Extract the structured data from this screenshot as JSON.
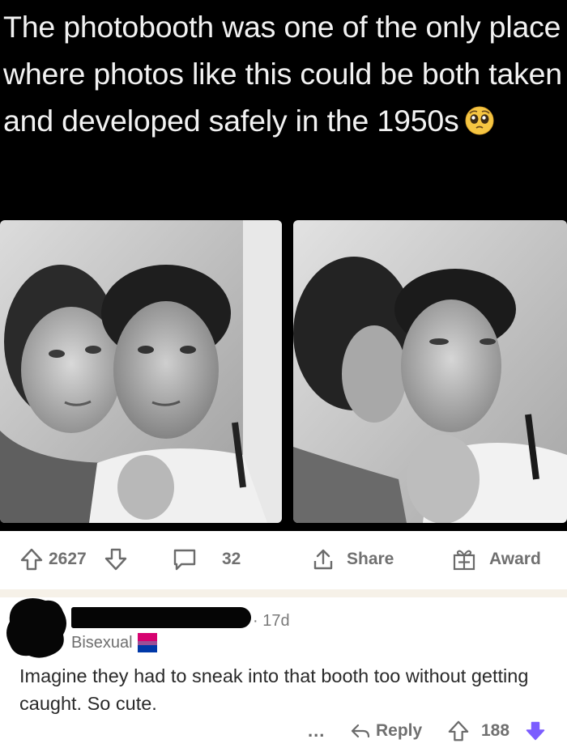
{
  "tweet": {
    "text": "The photobooth was one of the only place where photos like this could be both taken and developed safely in the 1950s",
    "emoji": "pleading-face-emoji"
  },
  "post_actions": {
    "upvote_count": "2627",
    "comment_count": "32",
    "share_label": "Share",
    "award_label": "Award"
  },
  "comment": {
    "timestamp": "· 17d",
    "flair": "Bisexual",
    "body": "Imagine they had to sneak into that booth too without getting caught. So cute.",
    "more_label": "...",
    "reply_label": "Reply",
    "score": "188"
  },
  "colors": {
    "background_top": "#000000",
    "upvote_accent": "#7b5cff",
    "bi_flag": [
      "#d60270",
      "#9b4f96",
      "#0038a8"
    ]
  }
}
